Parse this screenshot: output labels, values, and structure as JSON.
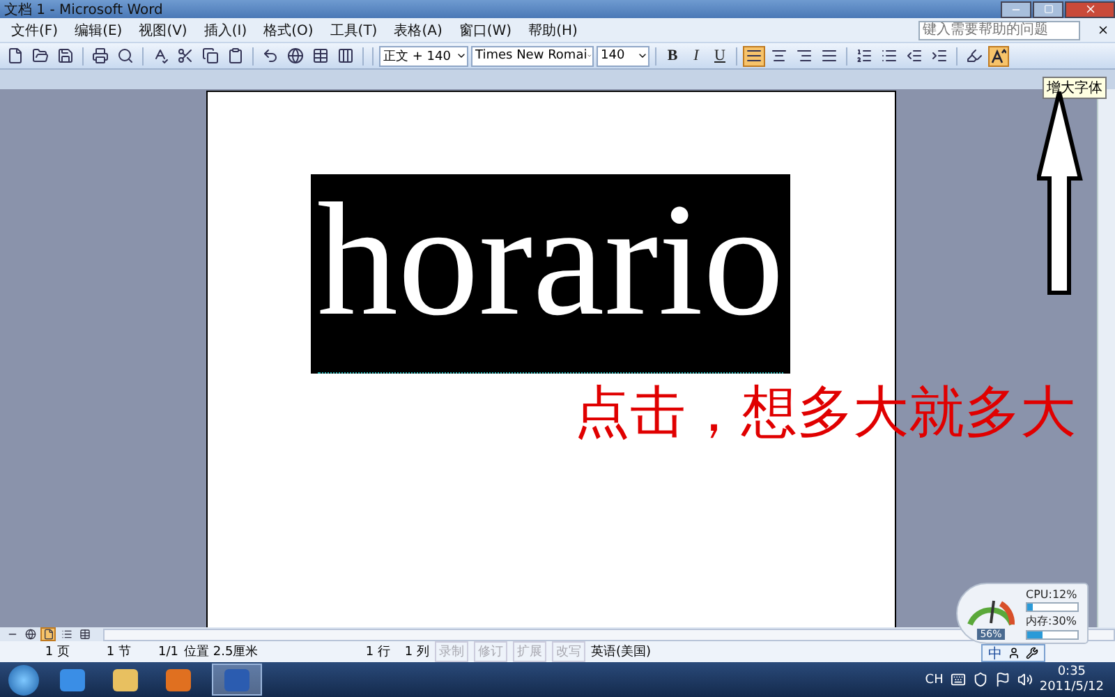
{
  "window": {
    "title": "文档 1 - Microsoft Word"
  },
  "menu": [
    {
      "label": "文件(F)"
    },
    {
      "label": "编辑(E)"
    },
    {
      "label": "视图(V)"
    },
    {
      "label": "插入(I)"
    },
    {
      "label": "格式(O)"
    },
    {
      "label": "工具(T)"
    },
    {
      "label": "表格(A)"
    },
    {
      "label": "窗口(W)"
    },
    {
      "label": "帮助(H)"
    }
  ],
  "help_search": {
    "placeholder": "键入需要帮助的问题"
  },
  "format_toolbar": {
    "style": "正文 + 140",
    "font": "Times New Romai",
    "size": "140",
    "bold": "B",
    "italic": "I",
    "underline": "U",
    "alignment_buttons": [
      {
        "kind": "justify",
        "selected": true
      },
      {
        "kind": "center",
        "selected": false
      },
      {
        "kind": "right",
        "selected": false
      },
      {
        "kind": "distributed",
        "selected": false
      }
    ],
    "grow_font_selected": true
  },
  "tooltip": "增大字体",
  "document": {
    "heading": "horario",
    "annotation": "点击，想多大就多大"
  },
  "view_buttons": [
    {
      "kind": "normal",
      "selected": false
    },
    {
      "kind": "web",
      "selected": false
    },
    {
      "kind": "print",
      "selected": true
    },
    {
      "kind": "outline",
      "selected": false
    },
    {
      "kind": "reading",
      "selected": false
    }
  ],
  "status_bar": {
    "page": "1 页",
    "section": "1 节",
    "pages": "1/1",
    "position": "位置 2.5厘米",
    "line": "1 行",
    "column": "1 列",
    "modes": [
      {
        "label": "录制",
        "disabled": true
      },
      {
        "label": "修订",
        "disabled": true
      },
      {
        "label": "扩展",
        "disabled": true
      },
      {
        "label": "改写",
        "disabled": true
      }
    ],
    "language": "英语(美国)"
  },
  "monitor": {
    "gauge": "56%",
    "meters": [
      {
        "label": "CPU:12%",
        "level": 0.12
      },
      {
        "label": "内存:30%",
        "level": 0.3
      }
    ]
  },
  "ime_bar": {
    "mode": "中"
  },
  "taskbar": {
    "apps": [
      {
        "kind": "ie",
        "selected": false
      },
      {
        "kind": "folder",
        "selected": false
      },
      {
        "kind": "media",
        "selected": false
      },
      {
        "kind": "word",
        "selected": true
      }
    ],
    "ime": "CH",
    "time": "0:35",
    "date": "2011/5/12"
  }
}
